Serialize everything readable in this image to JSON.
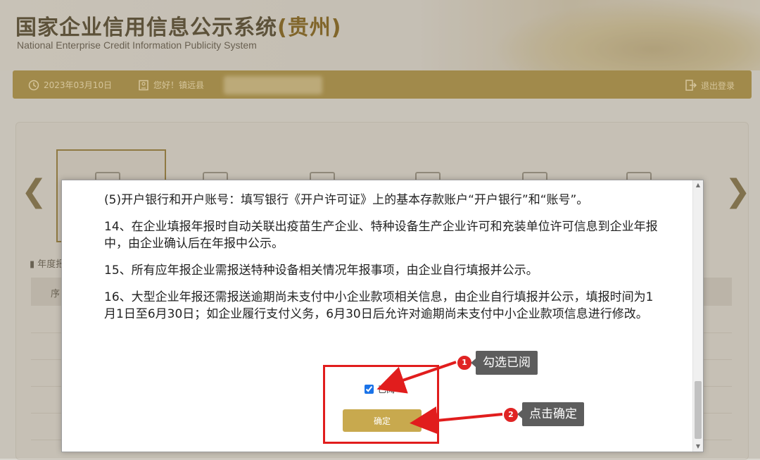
{
  "header": {
    "title_main": "国家企业信用信息公示系统",
    "title_province": "(贵州)",
    "subtitle": "National Enterprise Credit Information Publicity System"
  },
  "top_bar": {
    "date": "2023年03月10日",
    "greeting": "您好！镇远县",
    "logout": "退出登录"
  },
  "section_label": "年度报",
  "table": {
    "first_col_header": "序"
  },
  "nav": {
    "prev": "❮",
    "next": "❯"
  },
  "modal": {
    "paragraphs": [
      "(5)开户银行和开户账号：填写银行《开户许可证》上的基本存款账户“开户银行”和“账号”。",
      "14、在企业填报年报时自动关联出疫苗生产企业、特种设备生产企业许可和充装单位许可信息到企业年报中，由企业确认后在年报中公示。",
      "15、所有应年报企业需报送特种设备相关情况年报事项，由企业自行填报并公示。",
      "16、大型企业年报还需报送逾期尚未支付中小企业款项相关信息，由企业自行填报并公示，填报时间为1月1日至6月30日；如企业履行支付义务，6月30日后允许对逾期尚未支付中小企业款项信息进行修改。"
    ],
    "read_checkbox_label": "已阅",
    "read_checked": true,
    "confirm_label": "确定"
  },
  "annotations": {
    "step1_number": "1",
    "step1_text": "勾选已阅",
    "step2_number": "2",
    "step2_text": "点击确定",
    "highlight_color": "#e11d1d"
  },
  "colors": {
    "accent_gold": "#c8a94e",
    "bar_gold": "#a58a3c"
  }
}
